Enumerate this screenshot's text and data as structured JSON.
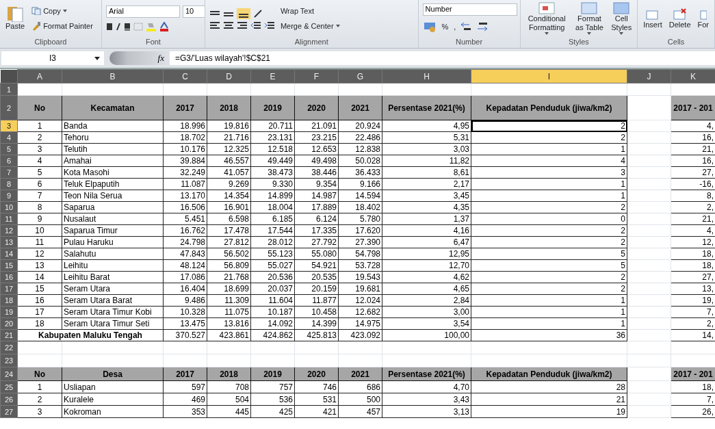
{
  "ribbon": {
    "clipboard": {
      "paste": "Paste",
      "copy": "Copy",
      "format_painter": "Format Painter",
      "label": "Clipboard"
    },
    "font": {
      "name": "Arial",
      "size": "10",
      "label": "Font"
    },
    "alignment": {
      "wrap_text": "Wrap Text",
      "merge": "Merge & Center",
      "label": "Alignment"
    },
    "number": {
      "format": "Number",
      "percent": "%",
      "comma": ",",
      "label": "Number"
    },
    "styles": {
      "conditional": "Conditional Formatting",
      "format_table": "Format as Table",
      "cell_styles": "Cell Styles",
      "label": "Styles"
    },
    "cells": {
      "insert": "Insert",
      "delete": "Delete",
      "format": "For",
      "label": "Cells"
    }
  },
  "formula_bar": {
    "name_box": "I3",
    "fx": "fx",
    "formula": "=G3/'Luas wilayah'!$C$21"
  },
  "columns": [
    {
      "label": "A",
      "selected": false
    },
    {
      "label": "B",
      "selected": false
    },
    {
      "label": "C",
      "selected": false
    },
    {
      "label": "D",
      "selected": false
    },
    {
      "label": "E",
      "selected": false
    },
    {
      "label": "F",
      "selected": false
    },
    {
      "label": "G",
      "selected": false
    },
    {
      "label": "H",
      "selected": false
    },
    {
      "label": "I",
      "selected": true
    },
    {
      "label": "J",
      "selected": false
    },
    {
      "label": "K",
      "selected": false
    }
  ],
  "row_headers": [
    {
      "label": "1",
      "selected": false
    },
    {
      "label": "2",
      "selected": false
    },
    {
      "label": "3",
      "selected": true
    },
    {
      "label": "4",
      "selected": false
    },
    {
      "label": "5",
      "selected": false
    },
    {
      "label": "6",
      "selected": false
    },
    {
      "label": "7",
      "selected": false
    },
    {
      "label": "8",
      "selected": false
    },
    {
      "label": "9",
      "selected": false
    },
    {
      "label": "10",
      "selected": false
    },
    {
      "label": "11",
      "selected": false
    },
    {
      "label": "12",
      "selected": false
    },
    {
      "label": "13",
      "selected": false
    },
    {
      "label": "14",
      "selected": false
    },
    {
      "label": "15",
      "selected": false
    },
    {
      "label": "16",
      "selected": false
    },
    {
      "label": "17",
      "selected": false
    },
    {
      "label": "18",
      "selected": false
    },
    {
      "label": "19",
      "selected": false
    },
    {
      "label": "20",
      "selected": false
    },
    {
      "label": "21",
      "selected": false
    },
    {
      "label": "22",
      "selected": false
    },
    {
      "label": "23",
      "selected": false
    },
    {
      "label": "24",
      "selected": false
    },
    {
      "label": "25",
      "selected": false
    },
    {
      "label": "26",
      "selected": false
    },
    {
      "label": "27",
      "selected": false
    }
  ],
  "table1": {
    "headers": [
      "No",
      "Kecamatan",
      "2017",
      "2018",
      "2019",
      "2020",
      "2021",
      "Persentase 2021(%)",
      "Kepadatan Penduduk (jiwa/km2)",
      "2017 - 201"
    ],
    "rows": [
      {
        "cells": [
          "1",
          "Banda",
          "18.996",
          "19.816",
          "20.711",
          "21.091",
          "20.924",
          "4,95",
          "2",
          "4,"
        ],
        "selected": true
      },
      {
        "cells": [
          "2",
          "Tehoru",
          "18.702",
          "21.716",
          "23.131",
          "23.215",
          "22.486",
          "5,31",
          "2",
          "16,"
        ],
        "selected": false
      },
      {
        "cells": [
          "3",
          "Telutih",
          "10.176",
          "12.325",
          "12.518",
          "12.653",
          "12.838",
          "3,03",
          "1",
          "21,"
        ],
        "selected": false
      },
      {
        "cells": [
          "4",
          "Amahai",
          "39.884",
          "46.557",
          "49.449",
          "49.498",
          "50.028",
          "11,82",
          "4",
          "16,"
        ],
        "selected": false
      },
      {
        "cells": [
          "5",
          "Kota Masohi",
          "32.249",
          "41.057",
          "38.473",
          "38.446",
          "36.433",
          "8,61",
          "3",
          "27,"
        ],
        "selected": false
      },
      {
        "cells": [
          "6",
          "Teluk Elpaputih",
          "11.087",
          "9.269",
          "9.330",
          "9.354",
          "9.166",
          "2,17",
          "1",
          "-16,"
        ],
        "selected": false
      },
      {
        "cells": [
          "7",
          "Teon Nila Serua",
          "13.170",
          "14.354",
          "14.899",
          "14.987",
          "14.594",
          "3,45",
          "1",
          "8,"
        ],
        "selected": false
      },
      {
        "cells": [
          "8",
          "Saparua",
          "16.506",
          "16.901",
          "18.004",
          "17.889",
          "18.402",
          "4,35",
          "2",
          "2,"
        ],
        "selected": false
      },
      {
        "cells": [
          "9",
          "Nusalaut",
          "5.451",
          "6.598",
          "6.185",
          "6.124",
          "5.780",
          "1,37",
          "0",
          "21,"
        ],
        "selected": false
      },
      {
        "cells": [
          "10",
          "Saparua Timur",
          "16.762",
          "17.478",
          "17.544",
          "17.335",
          "17.620",
          "4,16",
          "2",
          "4,"
        ],
        "selected": false
      },
      {
        "cells": [
          "11",
          "Pulau Haruku",
          "24.798",
          "27.812",
          "28.012",
          "27.792",
          "27.390",
          "6,47",
          "2",
          "12,"
        ],
        "selected": false
      },
      {
        "cells": [
          "12",
          "Salahutu",
          "47.843",
          "56.502",
          "55.123",
          "55.080",
          "54.798",
          "12,95",
          "5",
          "18,"
        ],
        "selected": false
      },
      {
        "cells": [
          "13",
          "Leihitu",
          "48.124",
          "56.809",
          "55.027",
          "54.921",
          "53.728",
          "12,70",
          "5",
          "18,"
        ],
        "selected": false
      },
      {
        "cells": [
          "14",
          "Leihitu Barat",
          "17.086",
          "21.768",
          "20.536",
          "20.535",
          "19.543",
          "4,62",
          "2",
          "27,"
        ],
        "selected": false
      },
      {
        "cells": [
          "15",
          "Seram Utara",
          "16.404",
          "18.699",
          "20.037",
          "20.159",
          "19.681",
          "4,65",
          "2",
          "13,"
        ],
        "selected": false
      },
      {
        "cells": [
          "16",
          "Seram Utara Barat",
          "9.486",
          "11.309",
          "11.604",
          "11.877",
          "12.024",
          "2,84",
          "1",
          "19,"
        ],
        "selected": false
      },
      {
        "cells": [
          "17",
          "Seram Utara Timur Kobi",
          "10.328",
          "11.075",
          "10.187",
          "10.458",
          "12.682",
          "3,00",
          "1",
          "7,"
        ],
        "selected": false
      },
      {
        "cells": [
          "18",
          "Seram Utara Timur Seti",
          "13.475",
          "13.816",
          "14.092",
          "14.399",
          "14.975",
          "3,54",
          "1",
          "2,"
        ],
        "selected": false
      }
    ],
    "total": {
      "label": "Kabupaten Maluku Tengah",
      "cells": [
        "370.527",
        "423.861",
        "424.862",
        "425.813",
        "423.092",
        "100,00",
        "36",
        "14,"
      ]
    }
  },
  "table2": {
    "headers": [
      "No",
      "Desa",
      "2017",
      "2018",
      "2019",
      "2020",
      "2021",
      "Persentase 2021(%)",
      "Kepadatan Penduduk (jiwa/km2)",
      "2017 - 201"
    ],
    "rows": [
      {
        "cells": [
          "1",
          "Usliapan",
          "597",
          "708",
          "757",
          "746",
          "686",
          "4,70",
          "28",
          "18,"
        ],
        "selected": false
      },
      {
        "cells": [
          "2",
          "Kuralele",
          "469",
          "504",
          "536",
          "531",
          "500",
          "3,43",
          "21",
          "7,"
        ],
        "selected": false
      },
      {
        "cells": [
          "3",
          "Kokroman",
          "353",
          "445",
          "425",
          "421",
          "457",
          "3,13",
          "19",
          "26,"
        ],
        "selected": false
      }
    ]
  }
}
